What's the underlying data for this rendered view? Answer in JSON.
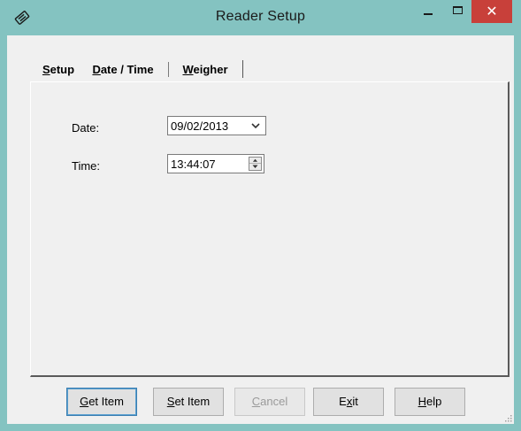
{
  "window": {
    "title": "Reader Setup",
    "icon": "reader-app-icon",
    "controls": {
      "minimize": "minimize-icon",
      "maximize": "maximize-icon",
      "close": "✕"
    }
  },
  "tabs": [
    {
      "label": "Setup",
      "underline": "S",
      "rest": "etup",
      "active": false
    },
    {
      "label": "Date / Time",
      "underline": "D",
      "rest": "ate / Time",
      "active": true
    },
    {
      "label": "Weigher",
      "underline": "W",
      "rest": "eigher",
      "active": false
    }
  ],
  "form": {
    "date_label": "Date:",
    "date_value": "09/02/2013",
    "time_label": "Time:",
    "time_value": "13:44:07"
  },
  "buttons": {
    "get_item": {
      "underline": "G",
      "rest": "et Item"
    },
    "set_item": {
      "underline": "S",
      "rest": "et Item"
    },
    "cancel": {
      "underline": "C",
      "rest": "ancel",
      "enabled": false
    },
    "exit": {
      "pre": "E",
      "underline": "x",
      "rest": "it"
    },
    "help": {
      "underline": "H",
      "rest": "elp"
    }
  },
  "colors": {
    "titlebar": "#84c3c1",
    "close": "#c8403a",
    "client": "#f0f0f0",
    "default_button_border": "#3c7fb1"
  }
}
